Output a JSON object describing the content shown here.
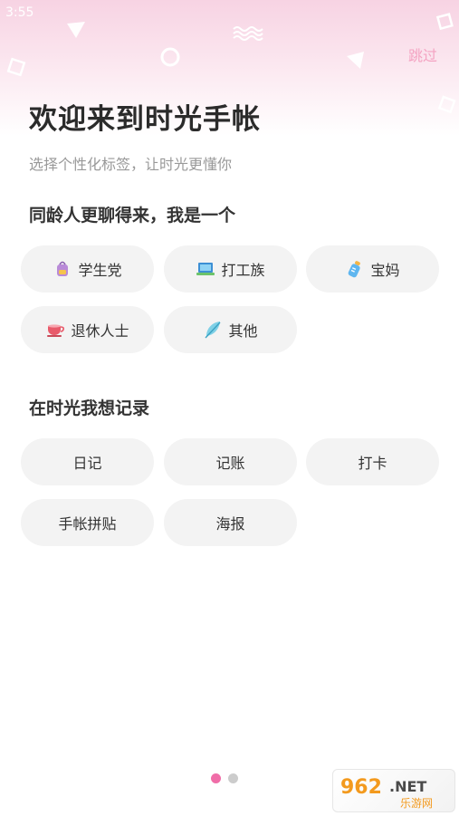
{
  "status_bar": {
    "time": "3:55"
  },
  "header": {
    "skip_label": "跳过"
  },
  "welcome": {
    "title": "欢迎来到时光手帐",
    "subtitle": "选择个性化标签，让时光更懂你"
  },
  "identity": {
    "title": "同龄人更聊得来，我是一个",
    "options": [
      {
        "label": "学生党",
        "icon": "backpack-icon"
      },
      {
        "label": "打工族",
        "icon": "laptop-icon"
      },
      {
        "label": "宝妈",
        "icon": "baby-bottle-icon"
      },
      {
        "label": "退休人士",
        "icon": "teacup-icon"
      },
      {
        "label": "其他",
        "icon": "feather-icon"
      }
    ]
  },
  "record": {
    "title": "在时光我想记录",
    "options": [
      {
        "label": "日记"
      },
      {
        "label": "记账"
      },
      {
        "label": "打卡"
      },
      {
        "label": "手帐拼贴"
      },
      {
        "label": "海报"
      }
    ]
  },
  "pager": {
    "active_color": "#f06da8",
    "inactive_color": "#cccccc"
  },
  "watermark": {
    "brand": "962.NET",
    "subtitle": "乐游网"
  },
  "colors": {
    "accent": "#f4a3c2",
    "chip_bg": "#f3f3f3"
  }
}
